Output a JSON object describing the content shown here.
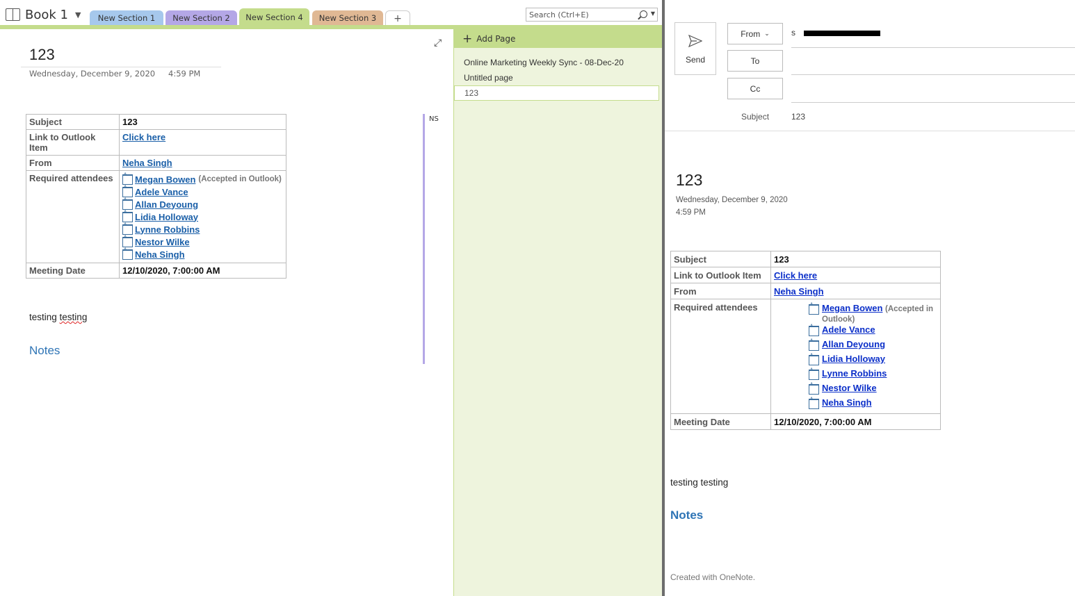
{
  "onenote": {
    "notebook_name": "Book 1",
    "sections": [
      {
        "label": "New Section 1",
        "color": "#a6c8ec"
      },
      {
        "label": "New Section 2",
        "color": "#b4a7e6"
      },
      {
        "label": "New Section 4",
        "color": "#c4dc8c",
        "active": true
      },
      {
        "label": "New Section 3",
        "color": "#e0b894"
      }
    ],
    "add_section_label": "+",
    "search_placeholder": "Search (Ctrl+E)",
    "page": {
      "title": "123",
      "date": "Wednesday, December 9, 2020",
      "time": "4:59 PM",
      "author_initials": "NS",
      "testing_text": "testing testing",
      "testing_word_1": "testing",
      "testing_word_2": "testing",
      "notes_heading": "Notes"
    },
    "add_page_label": "Add Page",
    "pages": [
      {
        "title": "Online Marketing Weekly Sync - 08-Dec-20"
      },
      {
        "title": "Untitled page"
      },
      {
        "title": "123",
        "selected": true
      }
    ]
  },
  "meeting": {
    "labels": {
      "subject": "Subject",
      "link": "Link to Outlook Item",
      "from": "From",
      "attendees": "Required attendees",
      "date": "Meeting Date"
    },
    "subject": "123",
    "link_text": "Click here",
    "from": "Neha Singh",
    "attendees": [
      {
        "name": "Megan Bowen",
        "status": "(Accepted in Outlook)"
      },
      {
        "name": "Adele Vance"
      },
      {
        "name": "Allan Deyoung"
      },
      {
        "name": "Lidia Holloway"
      },
      {
        "name": "Lynne Robbins"
      },
      {
        "name": "Nestor Wilke"
      },
      {
        "name": "Neha Singh"
      }
    ],
    "meeting_date": "12/10/2020, 7:00:00 AM"
  },
  "email": {
    "send_label": "Send",
    "from_label": "From",
    "to_label": "To",
    "cc_label": "Cc",
    "from_value_prefix": "s",
    "subject_label": "Subject",
    "subject_value": "123",
    "body_title": "123",
    "body_date": "Wednesday, December 9, 2020",
    "body_time": "4:59 PM",
    "testing_text": "testing testing",
    "notes_heading": "Notes",
    "footer": "Created with OneNote."
  }
}
